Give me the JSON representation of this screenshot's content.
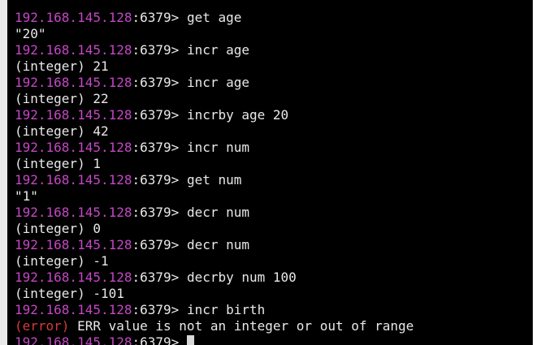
{
  "theme": {
    "background": "#000000",
    "text": "#e8e8e8",
    "host_color": "#c447c4",
    "error_color": "#d63a3a",
    "cursor_color": "#d8d8d8"
  },
  "prompt": {
    "host": "192.168.145.128",
    "port_suffix": ":6379> "
  },
  "lines": [
    {
      "kind": "prompt",
      "command": "get age"
    },
    {
      "kind": "output",
      "text": "\"20\""
    },
    {
      "kind": "prompt",
      "command": "incr age"
    },
    {
      "kind": "output",
      "text": "(integer) 21"
    },
    {
      "kind": "prompt",
      "command": "incr age"
    },
    {
      "kind": "output",
      "text": "(integer) 22"
    },
    {
      "kind": "prompt",
      "command": "incrby age 20"
    },
    {
      "kind": "output",
      "text": "(integer) 42"
    },
    {
      "kind": "prompt",
      "command": "incr num"
    },
    {
      "kind": "output",
      "text": "(integer) 1"
    },
    {
      "kind": "prompt",
      "command": "get num"
    },
    {
      "kind": "output",
      "text": "\"1\""
    },
    {
      "kind": "prompt",
      "command": "decr num"
    },
    {
      "kind": "output",
      "text": "(integer) 0"
    },
    {
      "kind": "prompt",
      "command": "decr num"
    },
    {
      "kind": "output",
      "text": "(integer) -1"
    },
    {
      "kind": "prompt",
      "command": "decrby num 100"
    },
    {
      "kind": "output",
      "text": "(integer) -101"
    },
    {
      "kind": "prompt",
      "command": "incr birth"
    },
    {
      "kind": "error",
      "label": "(error)",
      "text": " ERR value is not an integer or out of range"
    },
    {
      "kind": "prompt_active",
      "command": ""
    }
  ]
}
